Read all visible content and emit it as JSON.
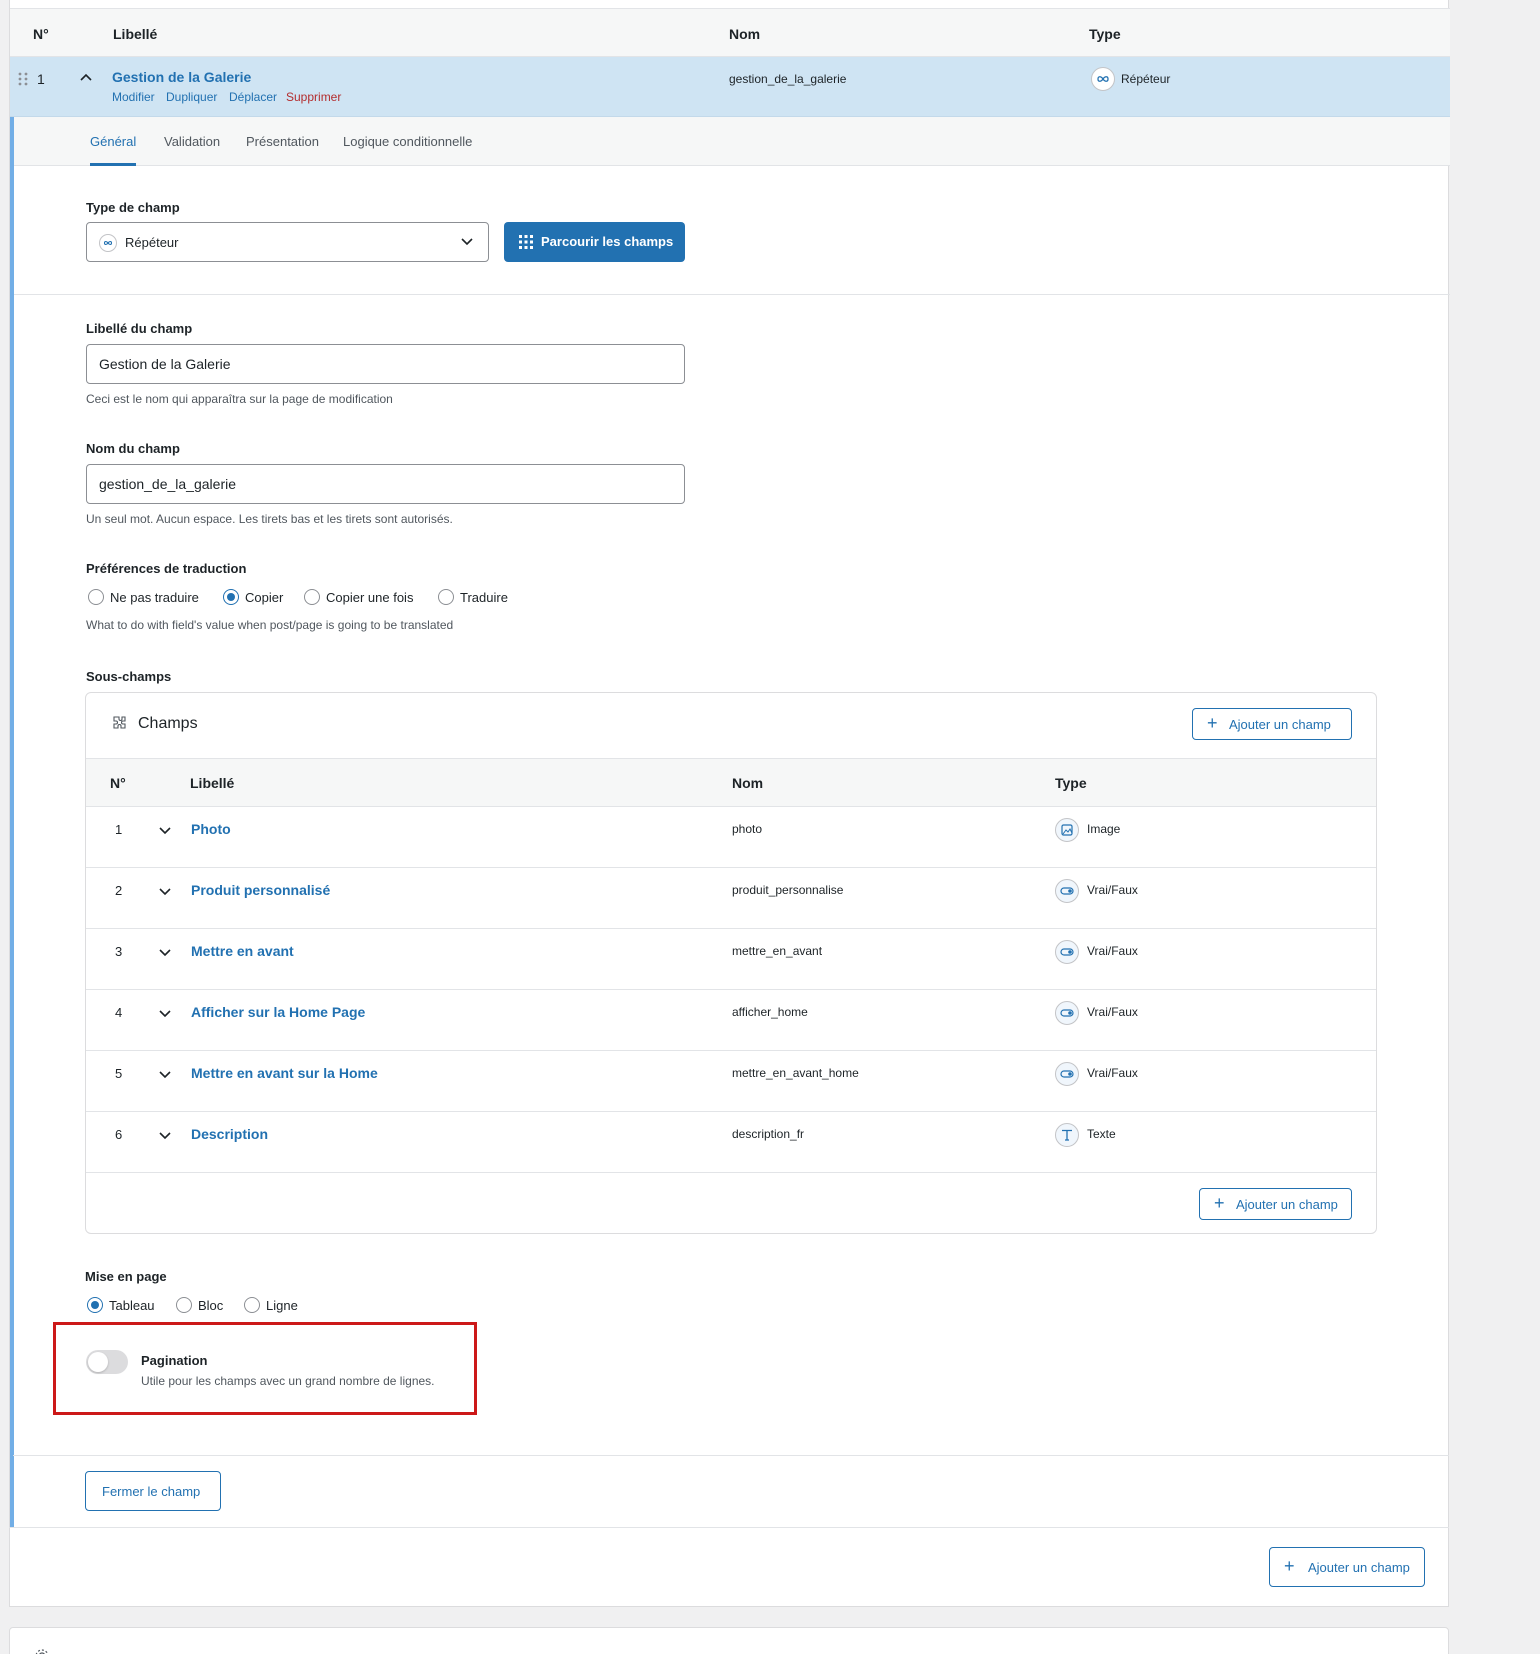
{
  "table_header": {
    "num": "N°",
    "label": "Libellé",
    "name": "Nom",
    "type": "Type"
  },
  "field": {
    "num": "1",
    "label": "Gestion de la Galerie",
    "actions": {
      "edit": "Modifier",
      "duplicate": "Dupliquer",
      "move": "Déplacer",
      "delete": "Supprimer"
    },
    "slug": "gestion_de_la_galerie",
    "type": "Répéteur"
  },
  "tabs": {
    "general": "Général",
    "validation": "Validation",
    "presentation": "Présentation",
    "conditional": "Logique conditionnelle"
  },
  "field_type": {
    "label": "Type de champ",
    "value": "Répéteur",
    "browse_button": "Parcourir les champs"
  },
  "field_label": {
    "label": "Libellé du champ",
    "value": "Gestion de la Galerie",
    "hint": "Ceci est le nom qui apparaîtra sur la page de modification"
  },
  "field_name": {
    "label": "Nom du champ",
    "value": "gestion_de_la_galerie",
    "hint": "Un seul mot. Aucun espace. Les tirets bas et les tirets sont autorisés."
  },
  "translation": {
    "label": "Préférences de traduction",
    "options": [
      "Ne pas traduire",
      "Copier",
      "Copier une fois",
      "Traduire"
    ],
    "selected": "Copier",
    "hint": "What to do with field's value when post/page is going to be translated"
  },
  "subfields": {
    "label": "Sous-champs",
    "title": "Champs",
    "add_button": "Ajouter un champ",
    "header": {
      "num": "N°",
      "label": "Libellé",
      "name": "Nom",
      "type": "Type"
    },
    "rows": [
      {
        "num": "1",
        "label": "Photo",
        "slug": "photo",
        "type": "Image",
        "icon": "image-icon"
      },
      {
        "num": "2",
        "label": "Produit personnalisé",
        "slug": "produit_personnalise",
        "type": "Vrai/Faux",
        "icon": "toggle-icon"
      },
      {
        "num": "3",
        "label": "Mettre en avant",
        "slug": "mettre_en_avant",
        "type": "Vrai/Faux",
        "icon": "toggle-icon"
      },
      {
        "num": "4",
        "label": "Afficher sur la Home Page",
        "slug": "afficher_home",
        "type": "Vrai/Faux",
        "icon": "toggle-icon"
      },
      {
        "num": "5",
        "label": "Mettre en avant sur la Home",
        "slug": "mettre_en_avant_home",
        "type": "Vrai/Faux",
        "icon": "toggle-icon"
      },
      {
        "num": "6",
        "label": "Description",
        "slug": "description_fr",
        "type": "Texte",
        "icon": "text-icon"
      }
    ]
  },
  "layout": {
    "label": "Mise en page",
    "options": [
      "Tableau",
      "Bloc",
      "Ligne"
    ],
    "selected": "Tableau"
  },
  "pagination": {
    "label": "Pagination",
    "hint": "Utile pour les champs avec un grand nombre de lignes.",
    "enabled": false
  },
  "close_button": "Fermer le champ",
  "add_field_button": "Ajouter un champ",
  "colors": {
    "accent": "#2271b1",
    "row_highlight": "#cfe4f3",
    "danger": "#b32d2e",
    "annotation": "#cc1818"
  }
}
